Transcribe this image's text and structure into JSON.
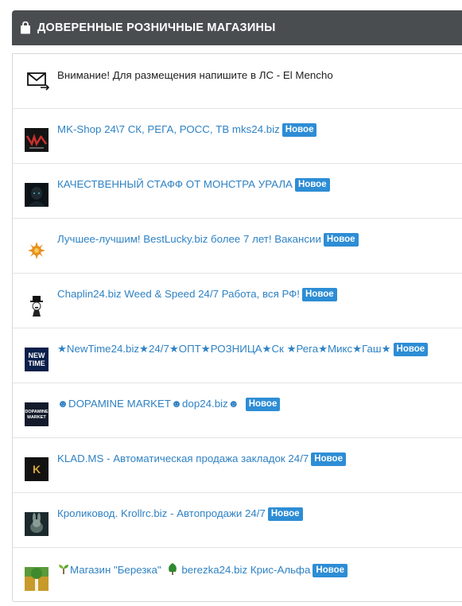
{
  "header": {
    "title": "ДОВЕРЕННЫЕ РОЗНИЧНЫЕ МАГАЗИНЫ",
    "icon": "shopping-bag-icon"
  },
  "notice": {
    "text": "Внимание! Для размещения напишите в ЛС - El Mencho",
    "icon": "mail-forward-icon"
  },
  "badge_label": "Новое",
  "shops": [
    {
      "title": "MK-Shop 24\\7 СК, РЕГА, РОСС, ТВ mks24.biz",
      "badge": "Новое"
    },
    {
      "title": "КАЧЕСТВЕННЫЙ СТАФФ ОТ МОНСТРА УРАЛА",
      "badge": "Новое"
    },
    {
      "title": "Лучшее-лучшим! BestLucky.biz более 7 лет! Вакансии",
      "badge": "Новое"
    },
    {
      "title": "Chaplin24.biz Weed & Speed 24/7 Работа, вся РФ!",
      "badge": "Новое"
    },
    {
      "title": "★NewTime24.biz★24/7★ОПТ★РОЗНИЦА★Ск ★Рега★Микс★Гаш★",
      "badge": "Новое",
      "thumb_text": "NEW TIME"
    },
    {
      "title_parts": [
        "☻DOPAMINE MARKET☻dop24.biz☻"
      ],
      "badge": "Новое",
      "thumb_text": "DOPAMINE MARKET"
    },
    {
      "title": "KLAD.MS - Автоматическая продажа закладок 24/7",
      "badge": "Новое",
      "thumb_text": "K"
    },
    {
      "title": "Кроликовод. Krollrc.biz - Автопродажи 24/7",
      "badge": "Новое"
    },
    {
      "title_a": "Магазин \"Березка\"",
      "title_b": "berezka24.biz Крис-Альфа",
      "badge": "Новое"
    }
  ],
  "colors": {
    "header_bg": "#4a4d50",
    "link": "#2f82c4",
    "badge": "#2d8dd5"
  }
}
